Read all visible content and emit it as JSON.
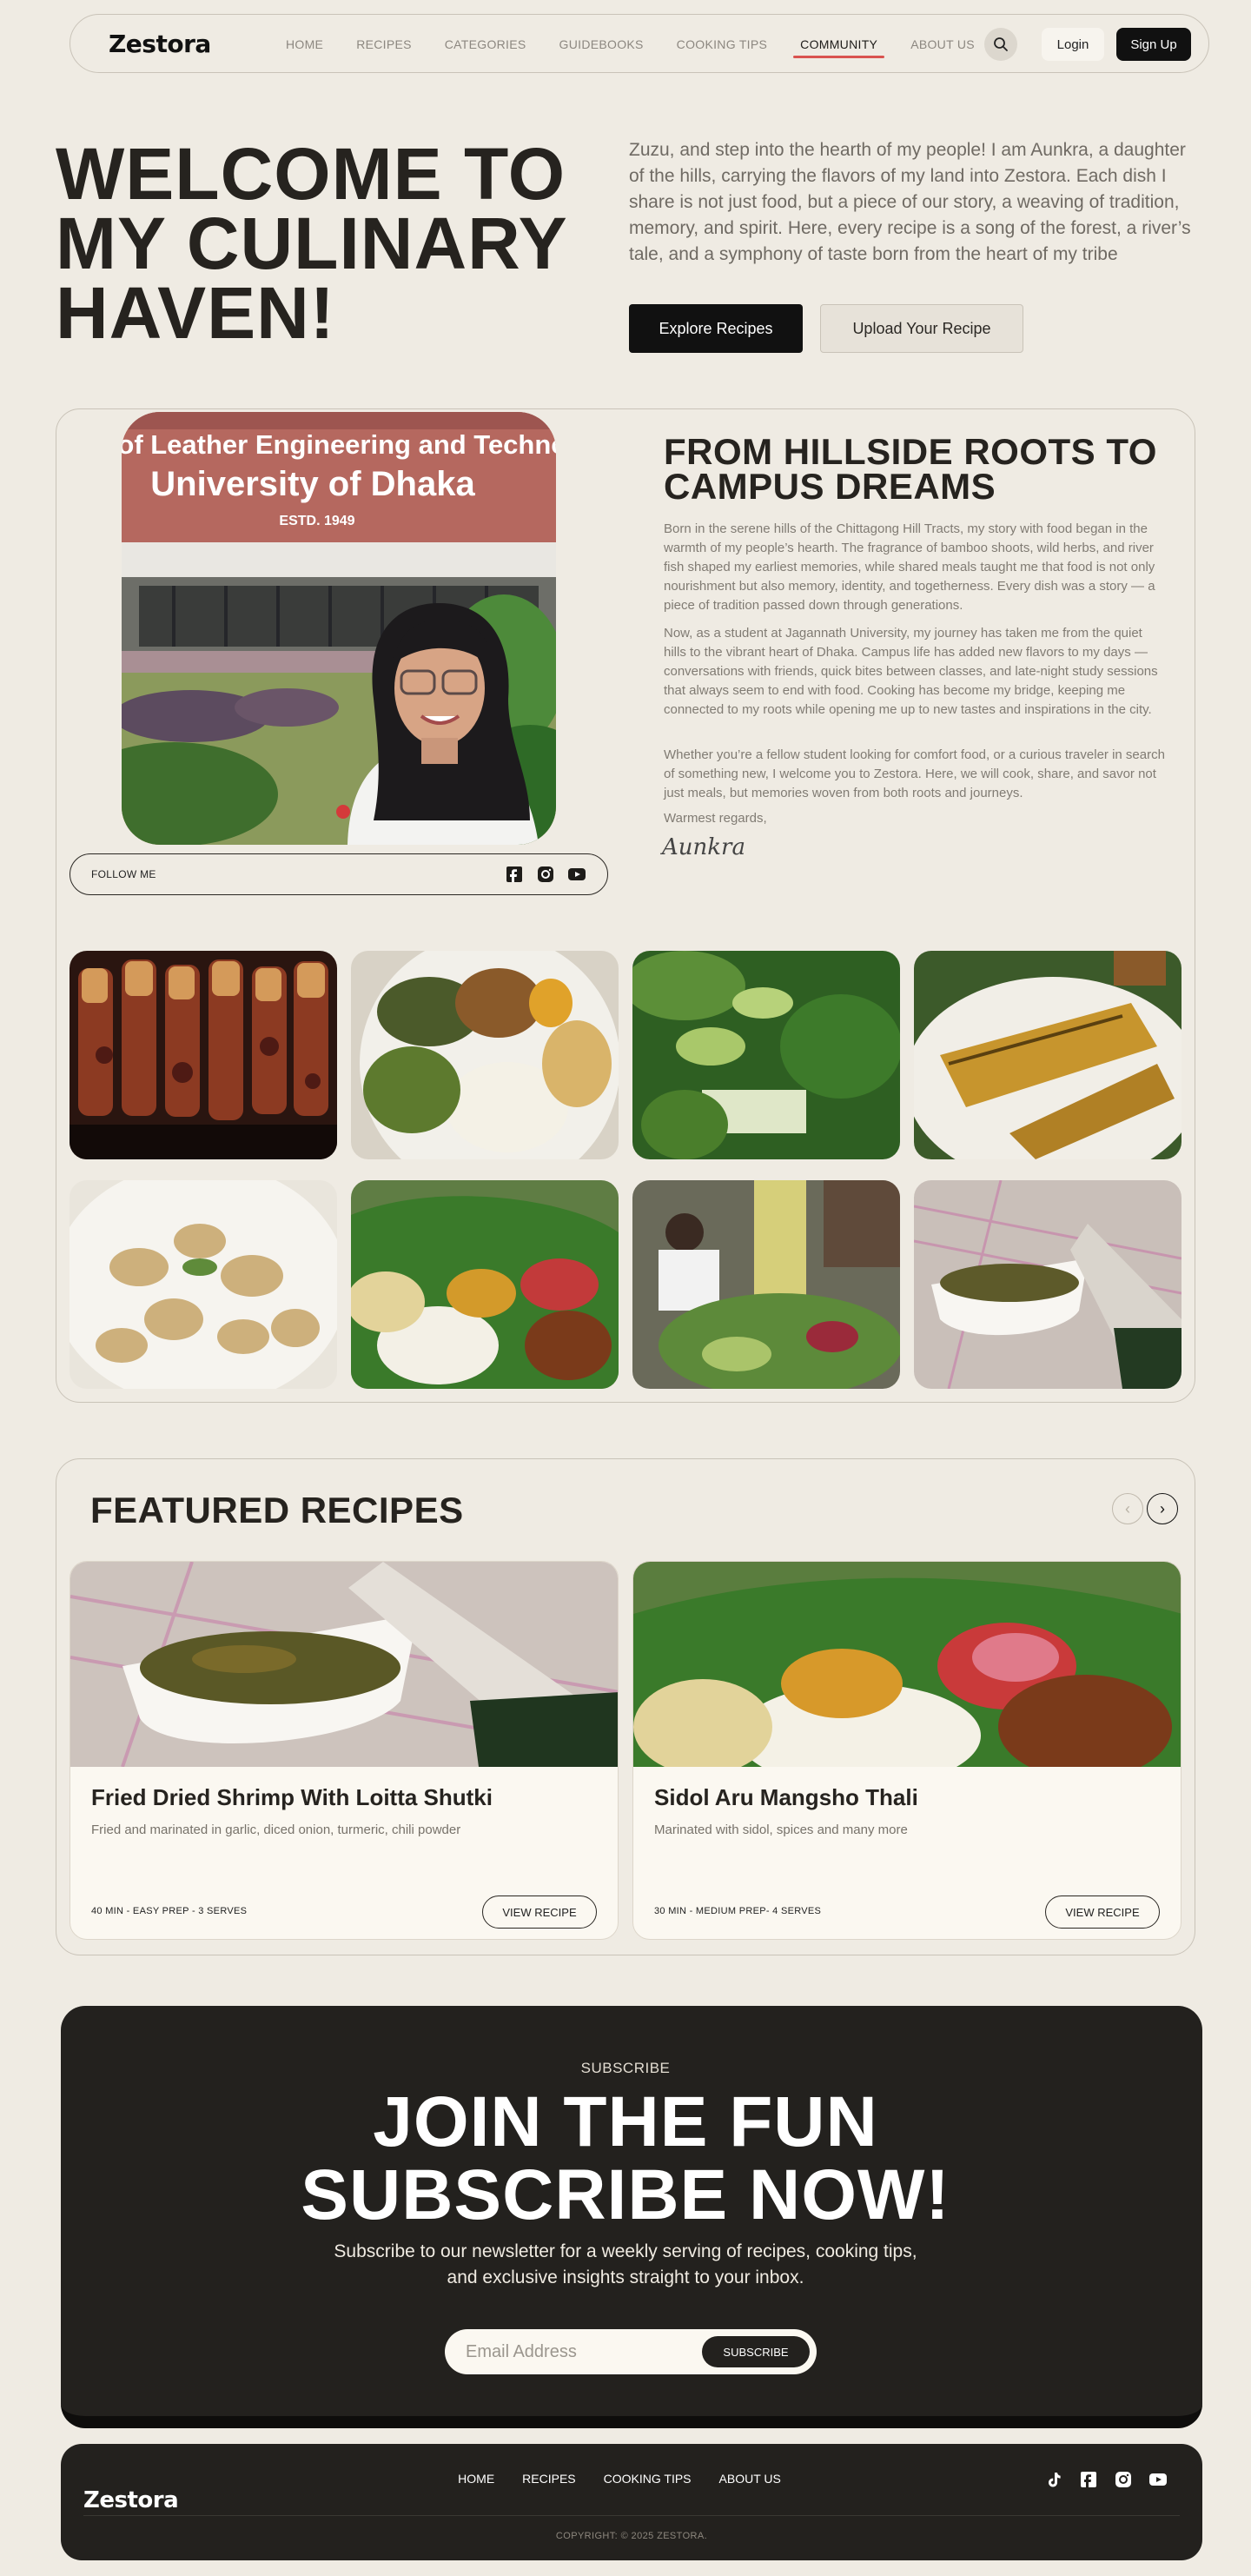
{
  "nav": {
    "logo": "Zestora",
    "links": [
      "HOME",
      "RECIPES",
      "CATEGORIES",
      "GUIDEBOOKS",
      "COOKING TIPS",
      "COMMUNITY",
      "ABOUT US"
    ],
    "active_link": "COMMUNITY",
    "login": "Login",
    "signup": "Sign Up"
  },
  "hero": {
    "title": "WELCOME TO MY CULINARY HAVEN!",
    "text": "Zuzu, and step into the hearth of my people! I am Aunkra, a daughter of the hills, carrying the flavors of my land into Zestora. Each dish I share is not just food, but a piece of our story, a weaving of tradition, memory, and spirit. Here, every recipe is a song of the forest, a river’s tale, and a symphony of taste born from the heart of my tribe",
    "primary_button": "Explore Recipes",
    "secondary_button": "Upload Your Recipe"
  },
  "about": {
    "sign_text": "ute of Leather Engineering and Technolog",
    "sign_university": "University of Dhaka",
    "sign_year": "ESTD. 1949",
    "follow_label": "FOLLOW ME",
    "heading": "FROM HILLSIDE ROOTS TO CAMPUS DREAMS",
    "paragraphs": [
      "Born in the serene hills of the Chittagong Hill Tracts, my story with food began in the warmth of my people’s hearth. The fragrance of bamboo shoots, wild herbs, and river fish shaped my earliest memories, while shared meals taught me that food is not only nourishment but also memory, identity, and togetherness. Every dish was a story — a piece of tradition passed down through generations.",
      "Now, as a student at Jagannath University, my journey has taken me from the quiet hills to the vibrant heart of Dhaka. Campus life has added new flavors to my days — conversations with friends, quick bites between classes, and late-night study sessions that always seem to end with food. Cooking has become my bridge, keeping me connected to my roots while opening me up to new tastes and inspirations in the city.",
      "Whether you’re a fellow student looking for comfort food, or a curious traveler in search of something new, I welcome you to Zestora. Here, we will cook, share, and savor not just meals, but memories woven from both roots and journeys.",
      "Warmest regards,"
    ],
    "signature": "Aunkra"
  },
  "featured": {
    "heading": "FEATURED RECIPES",
    "recipes": [
      {
        "title": "Fried Dried Shrimp With Loitta Shutki",
        "desc": "Fried and marinated in garlic, diced onion, turmeric, chili powder",
        "meta": "40 MIN - EASY PREP - 3 SERVES",
        "button": "VIEW RECIPE"
      },
      {
        "title": "Sidol Aru Mangsho Thali",
        "desc": "Marinated with sidol, spices and many more",
        "meta": "30 MIN - MEDIUM PREP- 4 SERVES",
        "button": "VIEW RECIPE"
      }
    ]
  },
  "subscribe": {
    "kicker": "SUBSCRIBE",
    "title_line1": "JOIN THE FUN",
    "title_line2": "SUBSCRIBE NOW!",
    "text": "Subscribe to our newsletter for a weekly serving of recipes, cooking tips, and exclusive insights straight to your inbox.",
    "placeholder": "Email Address",
    "button": "SUBSCRIBE"
  },
  "footer": {
    "logo": "Zestora",
    "links": [
      "HOME",
      "RECIPES",
      "COOKING TIPS",
      "ABOUT US"
    ],
    "copyright": "COPYRIGHT: © 2025 ZESTORA."
  }
}
